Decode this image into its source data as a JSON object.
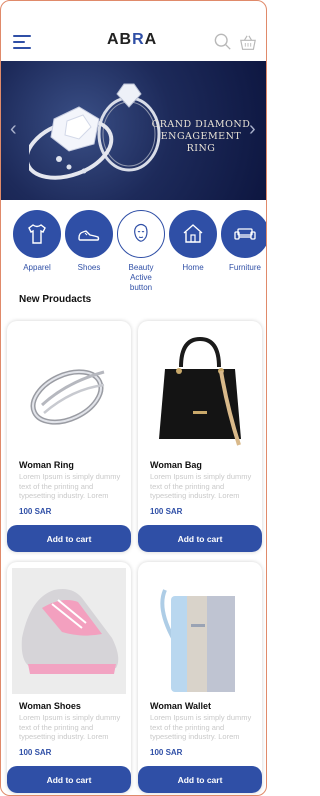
{
  "header": {
    "logo_part1": "AB",
    "logo_part2": "R",
    "logo_part3": "A",
    "icons": [
      "menu-icon",
      "search-icon",
      "cart-icon"
    ]
  },
  "banner": {
    "title": "GRAND DIAMOND ENGAGEMENT RING",
    "prev": "‹",
    "next": "›"
  },
  "categories": [
    {
      "label": "Apparel",
      "icon": "shirt-icon"
    },
    {
      "label": "Shoes",
      "icon": "shoe-icon"
    },
    {
      "label": "Beauty Active button",
      "icon": "face-icon"
    },
    {
      "label": "Home",
      "icon": "house-icon"
    },
    {
      "label": "Furniture",
      "icon": "sofa-icon"
    }
  ],
  "section_title": "New Proudacts",
  "products": [
    {
      "name": "Woman Ring",
      "desc": "Lorem Ipsum is simply dummy text of the printing and typesetting industry. Lorem",
      "price": "100 SAR",
      "button": "Add to cart"
    },
    {
      "name": "Woman Bag",
      "desc": "Lorem Ipsum is simply dummy text of the printing and typesetting industry. Lorem",
      "price": "100 SAR",
      "button": "Add to cart"
    },
    {
      "name": "Woman Shoes",
      "desc": "Lorem Ipsum is simply dummy text of the printing and typesetting industry. Lorem",
      "price": "100 SAR",
      "button": "Add to cart"
    },
    {
      "name": "Woman Wallet",
      "desc": "Lorem Ipsum is simply dummy text of the printing and typesetting industry. Lorem",
      "price": "100 SAR",
      "button": "Add to cart"
    }
  ],
  "colors": {
    "primary": "#2f4fa6",
    "banner": "#1d2a5a"
  }
}
